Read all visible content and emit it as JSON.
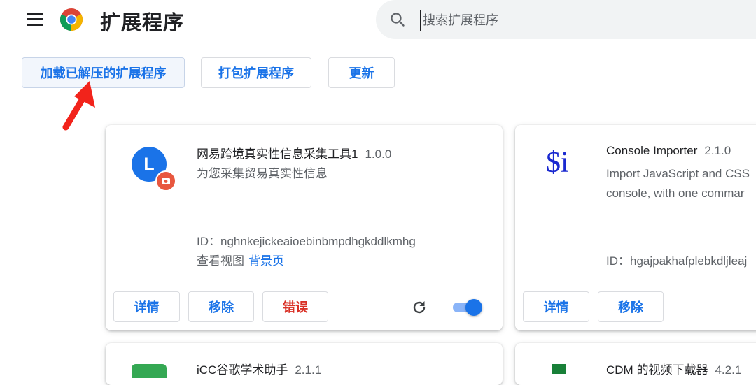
{
  "header": {
    "title": "扩展程序",
    "menu_icon": "menu-icon",
    "logo_icon": "chrome-logo",
    "search": {
      "placeholder": "搜索扩展程序",
      "value": "",
      "icon": "search-icon"
    }
  },
  "toolbar": {
    "load_unpacked": "加载已解压的扩展程序",
    "pack": "打包扩展程序",
    "update": "更新"
  },
  "annotation": {
    "arrow_color": "#f2231b"
  },
  "colors": {
    "accent": "#1a73e8",
    "error": "#d93025",
    "badge": "#e8573f"
  },
  "extensions": [
    {
      "icon_letter": "L",
      "name": "网易跨境真实性信息采集工具1",
      "version": "1.0.0",
      "description": "为您采集贸易真实性信息",
      "id_label": "ID：",
      "id": "nghnkejickeaioebinbmpdhgkddlkmhg",
      "views_label": "查看视图",
      "views_link": "背景页",
      "details": "详情",
      "remove": "移除",
      "error": "错误",
      "enabled": true
    },
    {
      "icon_text": "$i",
      "name": "Console Importer",
      "version": "2.1.0",
      "description": "Import JavaScript and CSS",
      "description_line2": "console, with one commar",
      "id_label": "ID：",
      "id": "hgajpakhafplebkdljleaj",
      "details": "详情",
      "remove": "移除"
    },
    {
      "name": "iCC谷歌学术助手",
      "version": "2.1.1"
    },
    {
      "name": "CDM 的视频下载器",
      "version": "4.2.1"
    }
  ]
}
